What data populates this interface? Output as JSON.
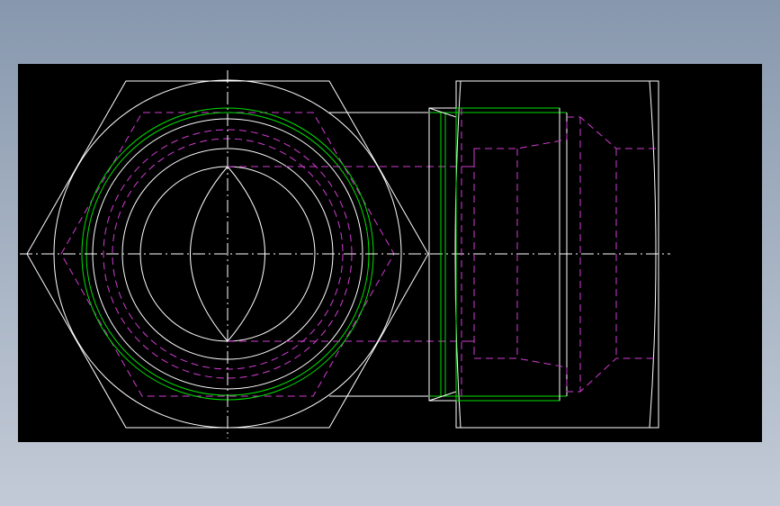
{
  "drawing": {
    "views": [
      "front-view",
      "side-view"
    ],
    "colors": {
      "background": "#000000",
      "outline": "#ffffff",
      "thread": "#00e000",
      "hidden_lines": "#d23cd2",
      "frame_gradient_top": "#8797ad",
      "frame_gradient_bottom": "#c3cad7"
    }
  }
}
